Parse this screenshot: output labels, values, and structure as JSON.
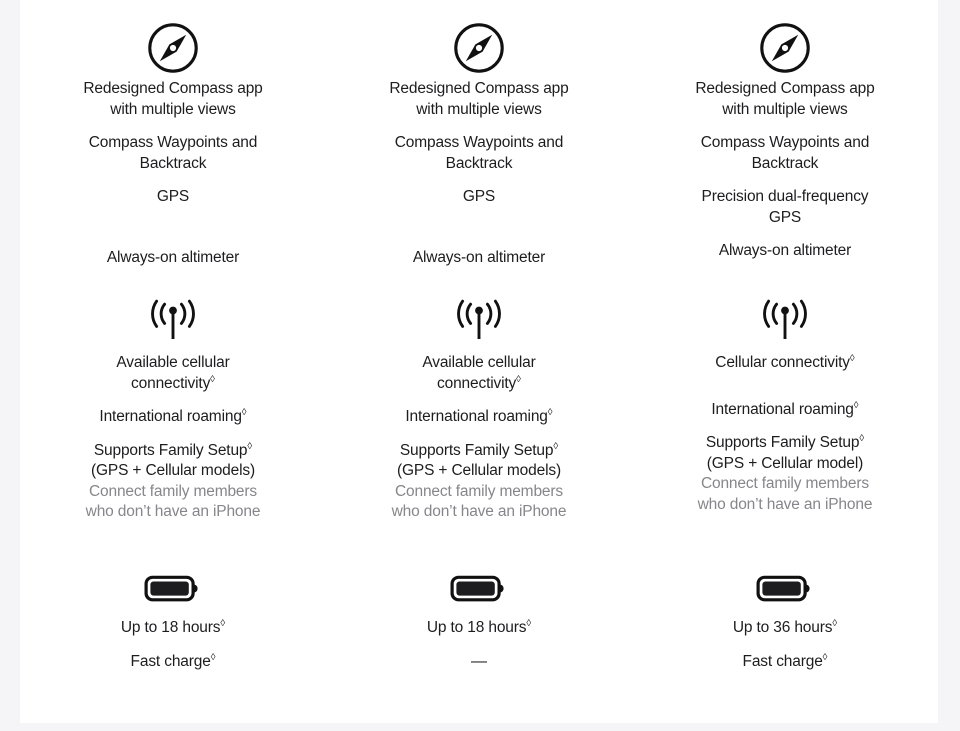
{
  "page": {
    "background_color": "#f5f5f7",
    "card_color": "#ffffff",
    "text_color": "#1d1d1f",
    "muted_text_color": "#86868b",
    "footnote_symbol": "◊"
  },
  "columns": [
    {
      "id": "column-1",
      "groups": {
        "compass": {
          "icon": "compass-icon",
          "lines": [
            {
              "text": "Redesigned Compass app",
              "muted": false,
              "gap": "0"
            },
            {
              "text": "with multiple views",
              "muted": false,
              "gap": "0"
            },
            {
              "text": "Compass Waypoints and",
              "muted": false,
              "gap": "1"
            },
            {
              "text": "Backtrack",
              "muted": false,
              "gap": "0"
            },
            {
              "text": "GPS",
              "muted": false,
              "gap": "1"
            },
            {
              "text": "Always-on altimeter",
              "muted": false,
              "gap": "3"
            }
          ]
        },
        "cellular": {
          "icon": "cellular-icon",
          "lines": [
            {
              "text": "Available cellular",
              "muted": false,
              "gap": "0"
            },
            {
              "text": "connectivity◊",
              "muted": false,
              "gap": "0"
            },
            {
              "text": "International roaming◊",
              "muted": false,
              "gap": "1"
            },
            {
              "text": "Supports Family Setup◊",
              "muted": false,
              "gap": "1"
            },
            {
              "text": "(GPS + Cellular models)",
              "muted": false,
              "gap": "0"
            },
            {
              "text": "Connect family members",
              "muted": true,
              "gap": "0"
            },
            {
              "text": "who don’t have an iPhone",
              "muted": true,
              "gap": "0"
            }
          ]
        },
        "battery": {
          "icon": "battery-icon",
          "lines": [
            {
              "text": "Up to 18 hours◊",
              "muted": false,
              "gap": "0"
            },
            {
              "text": "Fast charge◊",
              "muted": false,
              "gap": "1"
            }
          ]
        }
      }
    },
    {
      "id": "column-2",
      "groups": {
        "compass": {
          "icon": "compass-icon",
          "lines": [
            {
              "text": "Redesigned Compass app",
              "muted": false,
              "gap": "0"
            },
            {
              "text": "with multiple views",
              "muted": false,
              "gap": "0"
            },
            {
              "text": "Compass Waypoints and",
              "muted": false,
              "gap": "1"
            },
            {
              "text": "Backtrack",
              "muted": false,
              "gap": "0"
            },
            {
              "text": "GPS",
              "muted": false,
              "gap": "1"
            },
            {
              "text": "Always-on altimeter",
              "muted": false,
              "gap": "3"
            }
          ]
        },
        "cellular": {
          "icon": "cellular-icon",
          "lines": [
            {
              "text": "Available cellular",
              "muted": false,
              "gap": "0"
            },
            {
              "text": "connectivity◊",
              "muted": false,
              "gap": "0"
            },
            {
              "text": "International roaming◊",
              "muted": false,
              "gap": "1"
            },
            {
              "text": "Supports Family Setup◊",
              "muted": false,
              "gap": "1"
            },
            {
              "text": "(GPS + Cellular models)",
              "muted": false,
              "gap": "0"
            },
            {
              "text": "Connect family members",
              "muted": true,
              "gap": "0"
            },
            {
              "text": "who don’t have an iPhone",
              "muted": true,
              "gap": "0"
            }
          ]
        },
        "battery": {
          "icon": "battery-icon",
          "lines": [
            {
              "text": "Up to 18 hours◊",
              "muted": false,
              "gap": "0"
            },
            {
              "text": "—",
              "muted": false,
              "gap": "1"
            }
          ]
        }
      }
    },
    {
      "id": "column-3",
      "groups": {
        "compass": {
          "icon": "compass-icon",
          "lines": [
            {
              "text": "Redesigned Compass app",
              "muted": false,
              "gap": "0"
            },
            {
              "text": "with multiple views",
              "muted": false,
              "gap": "0"
            },
            {
              "text": "Compass Waypoints and",
              "muted": false,
              "gap": "1"
            },
            {
              "text": "Backtrack",
              "muted": false,
              "gap": "0"
            },
            {
              "text": "Precision dual-frequency",
              "muted": false,
              "gap": "1"
            },
            {
              "text": "GPS",
              "muted": false,
              "gap": "0"
            },
            {
              "text": "Always-on altimeter",
              "muted": false,
              "gap": "1"
            }
          ]
        },
        "cellular": {
          "icon": "cellular-icon",
          "lines": [
            {
              "text": "Cellular connectivity◊",
              "muted": false,
              "gap": "0"
            },
            {
              "text": "International roaming◊",
              "muted": false,
              "gap": "2"
            },
            {
              "text": "Supports Family Setup◊",
              "muted": false,
              "gap": "1"
            },
            {
              "text": "(GPS + Cellular model)",
              "muted": false,
              "gap": "0"
            },
            {
              "text": "Connect family members",
              "muted": true,
              "gap": "0"
            },
            {
              "text": "who don’t have an iPhone",
              "muted": true,
              "gap": "0"
            }
          ]
        },
        "battery": {
          "icon": "battery-icon",
          "lines": [
            {
              "text": "Up to 36 hours◊",
              "muted": false,
              "gap": "0"
            },
            {
              "text": "Fast charge◊",
              "muted": false,
              "gap": "1"
            }
          ]
        }
      }
    }
  ]
}
